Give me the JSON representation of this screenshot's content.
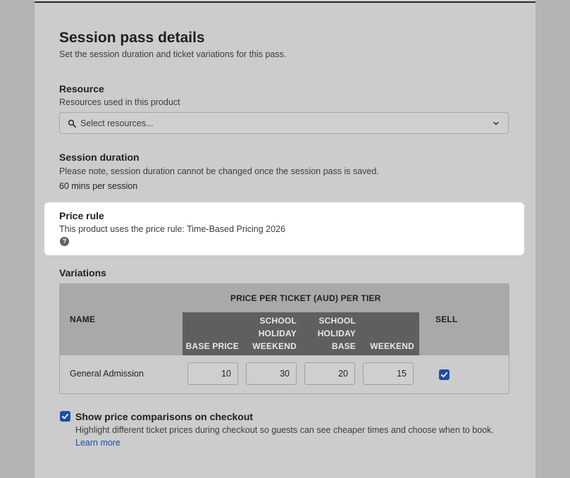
{
  "header": {
    "title": "Session pass details",
    "subtitle": "Set the session duration and ticket variations for this pass."
  },
  "resource": {
    "title": "Resource",
    "description": "Resources used in this product",
    "placeholder": "Select resources..."
  },
  "session_duration": {
    "title": "Session duration",
    "note": "Please note, session duration cannot be changed once the session pass is saved.",
    "value": "60 mins per session"
  },
  "price_rule": {
    "title": "Price rule",
    "description": "This product uses the price rule: Time-Based Pricing 2026",
    "help_glyph": "?"
  },
  "variations": {
    "title": "Variations",
    "group_header": "PRICE PER TICKET (AUD) PER TIER",
    "name_header": "NAME",
    "sell_header": "SELL",
    "tiers": [
      {
        "lines": [
          "BASE PRICE"
        ]
      },
      {
        "lines": [
          "SCHOOL",
          "HOLIDAY",
          "WEEKEND"
        ]
      },
      {
        "lines": [
          "SCHOOL",
          "HOLIDAY",
          "BASE"
        ]
      },
      {
        "lines": [
          "WEEKEND"
        ]
      }
    ],
    "rows": [
      {
        "name": "General Admission",
        "prices": [
          "10",
          "30",
          "20",
          "15"
        ],
        "sell": true
      }
    ]
  },
  "price_comparison": {
    "checked": true,
    "label": "Show price comparisons on checkout",
    "description": "Highlight different ticket prices during checkout so guests can see cheaper times and choose when to book.",
    "link": "Learn more"
  },
  "colors": {
    "accent": "#1d4ea6",
    "tier_header_bg": "#5f5f5f",
    "overlay_panel": "#cccccc",
    "highlight": "#ffffff"
  }
}
